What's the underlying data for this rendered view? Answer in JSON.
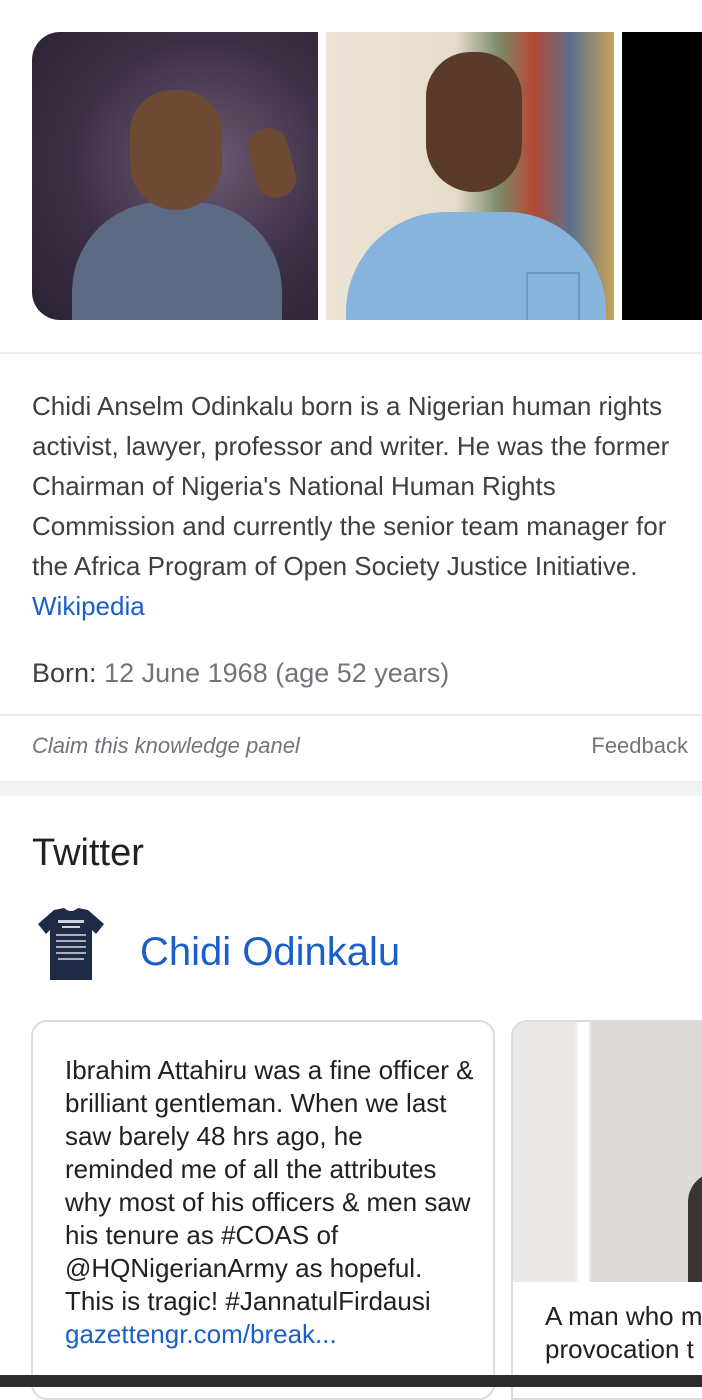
{
  "knowledge_panel": {
    "description": "Chidi Anselm Odinkalu born is a Nigerian human rights activist, lawyer, professor and writer. He was the former Chairman of Nigeria's National Human Rights Commission and currently the senior team manager for the Africa Program of Open Society Justice Initiative.",
    "source_link": "Wikipedia",
    "born_label": "Born:",
    "born_value": "12 June 1968 (age 52 years)",
    "claim_label": "Claim this knowledge panel",
    "feedback_label": "Feedback"
  },
  "twitter": {
    "section_title": "Twitter",
    "account_name": "Chidi Odinkalu",
    "tweets": [
      {
        "text": "Ibrahim Attahiru was a fine officer & brilliant gentleman. When we last saw barely 48 hrs ago, he reminded me of all the attributes why most of his officers & men saw his tenure as #COAS of @HQNigerianArmy as hopeful. This is tragic! #JannatulFirdausi",
        "link": "gazettengr.com/break..."
      },
      {
        "text_line1": "A man who m",
        "text_line2": "provocation t"
      }
    ]
  },
  "colors": {
    "link": "#1a5fc9",
    "text": "#3c4043",
    "muted": "#70757a",
    "border": "#dadce0"
  }
}
